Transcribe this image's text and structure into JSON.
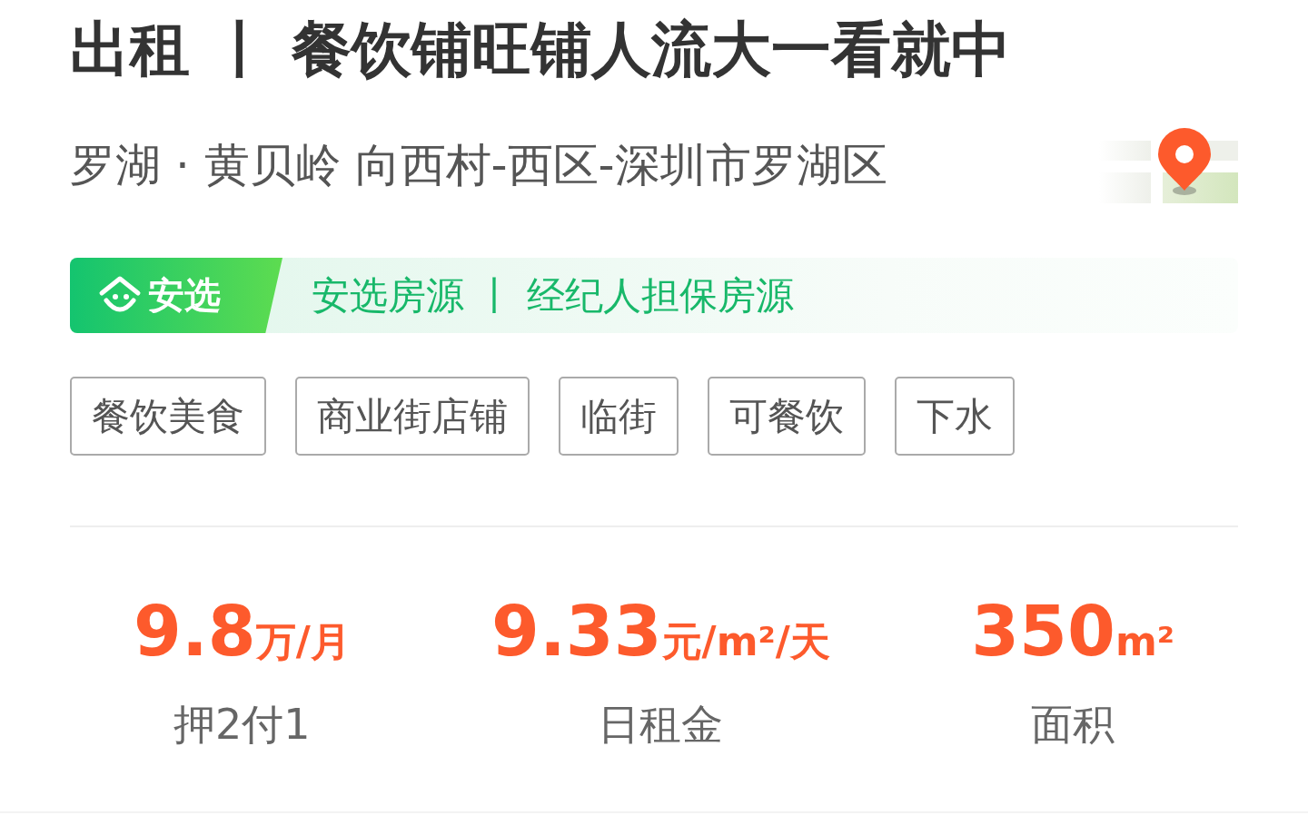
{
  "title": "出租 丨 餐饮铺旺铺人流大一看就中",
  "address": "罗湖 · 黄贝岭 向西村-西区-深圳市罗湖区",
  "banner": {
    "badge": "安选",
    "text": "安选房源 丨 经纪人担保房源"
  },
  "tags": [
    "餐饮美食",
    "商业街店铺",
    "临街",
    "可餐饮",
    "下水"
  ],
  "stats": [
    {
      "value": "9.8",
      "unit": "万/月",
      "label": "押2付1"
    },
    {
      "value": "9.33",
      "unit": "元/m²/天",
      "label": "日租金"
    },
    {
      "value": "350",
      "unit": "m²",
      "label": "面积"
    }
  ]
}
